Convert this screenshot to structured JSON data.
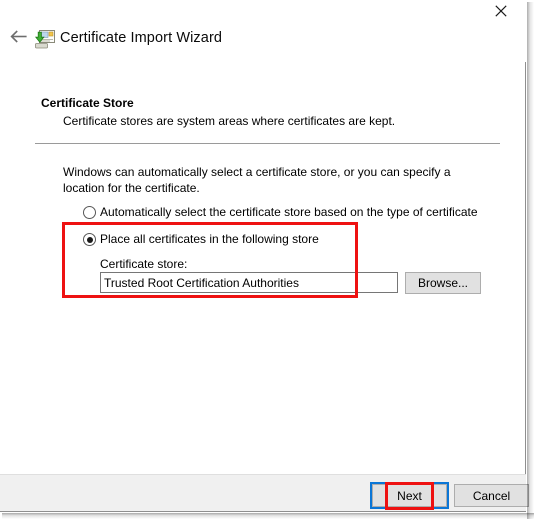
{
  "window": {
    "title": "Certificate Import Wizard",
    "icon": "certificate-import-icon",
    "back_icon": "back-arrow-icon",
    "close_icon": "close-icon"
  },
  "page": {
    "heading": "Certificate Store",
    "subheading": "Certificate stores are system areas where certificates are kept.",
    "intro": "Windows can automatically select a certificate store, or you can specify a location for the certificate."
  },
  "options": {
    "auto": {
      "label": "Automatically select the certificate store based on the type of certificate",
      "selected": false
    },
    "place": {
      "label": "Place all certificates in the following store",
      "selected": true
    }
  },
  "store": {
    "label": "Certificate store:",
    "value": "Trusted Root Certification Authorities",
    "placeholder": "",
    "browse_label": "Browse..."
  },
  "footer": {
    "next_label": "Next",
    "cancel_label": "Cancel"
  },
  "annotations": {
    "highlight_color": "#ee1111",
    "focus_color": "#0b76d6",
    "boxes": [
      "place-all-certificates-store-group",
      "next-button"
    ]
  }
}
